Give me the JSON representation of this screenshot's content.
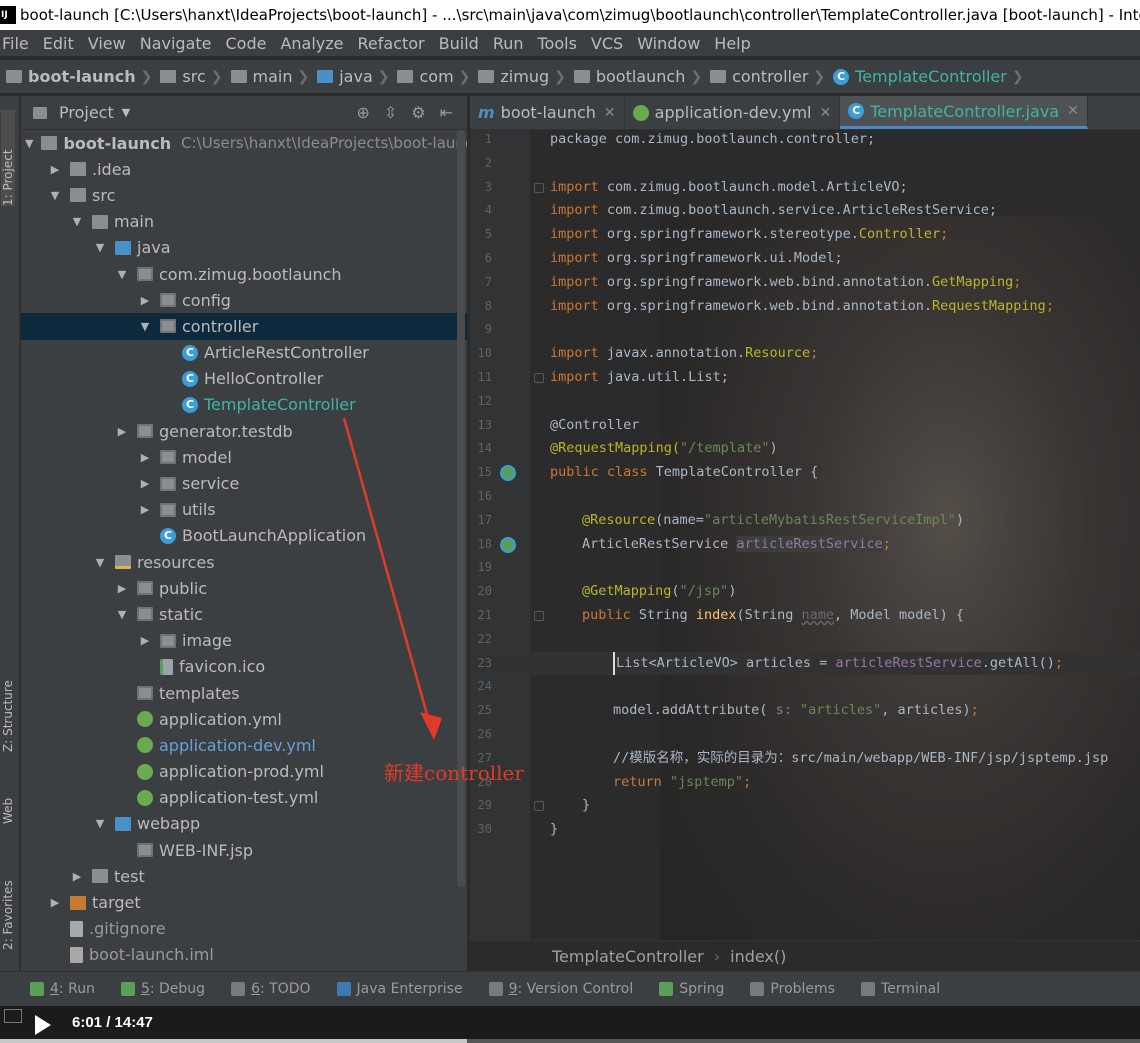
{
  "window": {
    "title": "boot-launch [C:\\Users\\hanxt\\IdeaProjects\\boot-launch] - ...\\src\\main\\java\\com\\zimug\\bootlaunch\\controller\\TemplateController.java [boot-launch] - IntelliJ"
  },
  "menu": [
    "File",
    "Edit",
    "View",
    "Navigate",
    "Code",
    "Analyze",
    "Refactor",
    "Build",
    "Run",
    "Tools",
    "VCS",
    "Window",
    "Help"
  ],
  "breadcrumbs": [
    "boot-launch",
    "src",
    "main",
    "java",
    "com",
    "zimug",
    "bootlaunch",
    "controller",
    "TemplateController"
  ],
  "side_tabs": {
    "project": "1: Project",
    "structure": "Z: Structure",
    "web": "Web",
    "favorites": "2: Favorites"
  },
  "project_panel": {
    "title": "Project",
    "root_label": "boot-launch",
    "root_path": "C:\\Users\\hanxt\\IdeaProjects\\boot-launch",
    "tree": [
      {
        "label": ".idea"
      },
      {
        "label": "src"
      },
      {
        "label": "main"
      },
      {
        "label": "java"
      },
      {
        "label": "com.zimug.bootlaunch"
      },
      {
        "label": "config"
      },
      {
        "label": "controller"
      },
      {
        "label": "ArticleRestController"
      },
      {
        "label": "HelloController"
      },
      {
        "label": "TemplateController"
      },
      {
        "label": "generator.testdb"
      },
      {
        "label": "model"
      },
      {
        "label": "service"
      },
      {
        "label": "utils"
      },
      {
        "label": "BootLaunchApplication"
      },
      {
        "label": "resources"
      },
      {
        "label": "public"
      },
      {
        "label": "static"
      },
      {
        "label": "image"
      },
      {
        "label": "favicon.ico"
      },
      {
        "label": "templates"
      },
      {
        "label": "application.yml"
      },
      {
        "label": "application-dev.yml"
      },
      {
        "label": "application-prod.yml"
      },
      {
        "label": "application-test.yml"
      },
      {
        "label": "webapp"
      },
      {
        "label": "WEB-INF.jsp"
      },
      {
        "label": "test"
      },
      {
        "label": "target"
      },
      {
        "label": ".gitignore"
      },
      {
        "label": "boot-launch.iml"
      }
    ]
  },
  "editor_tabs": [
    {
      "label": "boot-launch",
      "icon": "m-module-icon"
    },
    {
      "label": "application-dev.yml",
      "icon": "spring-icon"
    },
    {
      "label": "TemplateController.java",
      "icon": "class-icon"
    }
  ],
  "code": {
    "line1": "package com.zimug.bootlaunch.controller;",
    "l3a": "import ",
    "l3b": "com.zimug.bootlaunch.model.ArticleVO;",
    "l4a": "import ",
    "l4b": "com.zimug.bootlaunch.service.ArticleRestService;",
    "l5a": "import ",
    "l5b": "org.springframework.stereotype.",
    "l5c": "Controller",
    "l5d": ";",
    "l6a": "import ",
    "l6b": "org.springframework.ui.Model;",
    "l7a": "import ",
    "l7b": "org.springframework.web.bind.annotation.",
    "l7c": "GetMapping",
    "l7d": ";",
    "l8a": "import ",
    "l8b": "org.springframework.web.bind.annotation.",
    "l8c": "RequestMapping",
    "l8d": ";",
    "l10a": "import ",
    "l10b": "javax.annotation.",
    "l10c": "Resource",
    "l10d": ";",
    "l11a": "import ",
    "l11b": "java.util.List;",
    "l13": "@Controller",
    "l14a": "@RequestMapping(",
    "l14b": "\"/template\"",
    "l14c": ")",
    "l15a": "public class ",
    "l15b": "TemplateController {",
    "l17a": "@Resource",
    "l17b": "(name=",
    "l17c": "\"articleMybatisRestServiceImpl\"",
    "l17d": ")",
    "l18a": "ArticleRestService ",
    "l18b": "articleRestService",
    "l18c": ";",
    "l20a": "@GetMapping",
    "l20b": "(",
    "l20c": "\"/jsp\"",
    "l20d": ")",
    "l21a": "public ",
    "l21b": "String ",
    "l21c": "index",
    "l21d": "(String ",
    "l21e": "name",
    "l21f": ", Model model) {",
    "l23a": "List<ArticleVO> articles = ",
    "l23b": "articleRestService",
    "l23c": ".getAll()",
    "l23d": ";",
    "l25a": "model.addAttribute( ",
    "l25b": "s: ",
    "l25c": "\"articles\"",
    "l25d": ", articles)",
    "l25e": ";",
    "l27": "//模版名称，实际的目录为：src/main/webapp/WEB-INF/jsp/jsptemp.jsp",
    "l28a": "return ",
    "l28b": "\"jsptemp\"",
    "l28c": ";",
    "l29": "}",
    "l30": "}"
  },
  "line_numbers": [
    "1",
    "2",
    "3",
    "4",
    "5",
    "6",
    "7",
    "8",
    "9",
    "10",
    "11",
    "12",
    "13",
    "14",
    "15",
    "16",
    "17",
    "18",
    "19",
    "20",
    "21",
    "22",
    "23",
    "24",
    "25",
    "26",
    "27",
    "28",
    "29",
    "30"
  ],
  "editor_breadcrumb": [
    "TemplateController",
    "index()"
  ],
  "bottom_tools": [
    {
      "num": "4",
      "label": ": Run"
    },
    {
      "num": "5",
      "label": ": Debug"
    },
    {
      "num": "6",
      "label": ": TODO"
    },
    {
      "num": "",
      "label": "Java Enterprise"
    },
    {
      "num": "9",
      "label": ": Version Control"
    },
    {
      "num": "",
      "label": "Spring"
    },
    {
      "num": "",
      "label": "Problems"
    },
    {
      "num": "",
      "label": "Terminal"
    }
  ],
  "video": {
    "time": "6:01 / 14:47",
    "progress": 0.41
  },
  "annotation": {
    "text": "新建controller",
    "color": "#e03a2a"
  }
}
